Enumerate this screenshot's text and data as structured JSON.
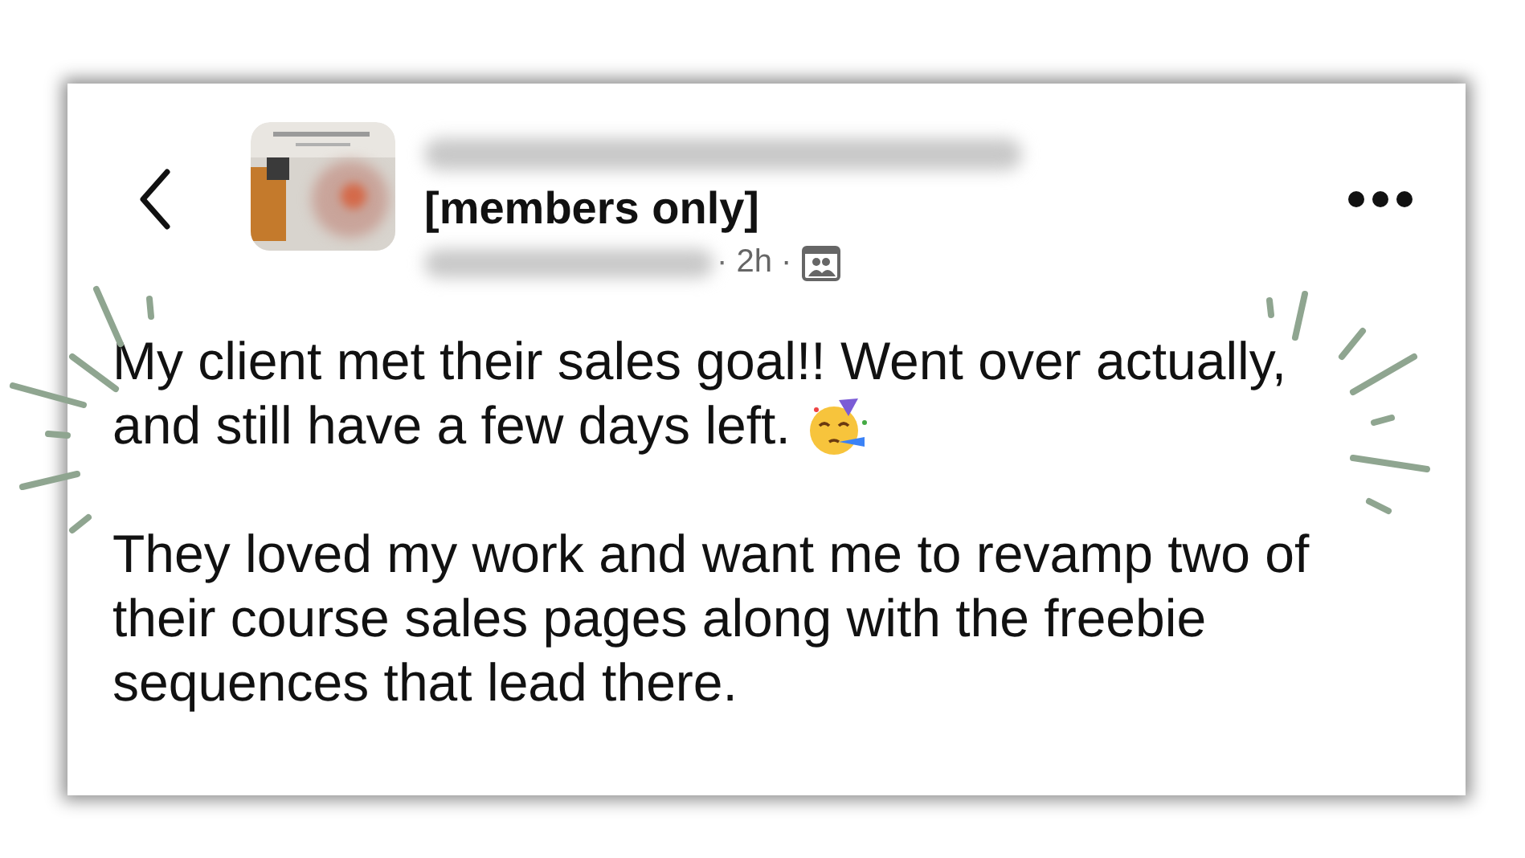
{
  "header": {
    "group_label": "[members only]",
    "meta": "· 2h ·"
  },
  "post": {
    "paragraphs": [
      {
        "lines": [
          "My client met their sales goal!! Went over actually,",
          "and still have a few days left."
        ],
        "emoji": true
      },
      {
        "lines": [
          "They loved my work and want me to revamp two of",
          "their course sales pages along with the freebie",
          "sequences that lead there."
        ],
        "emoji": false
      }
    ]
  }
}
